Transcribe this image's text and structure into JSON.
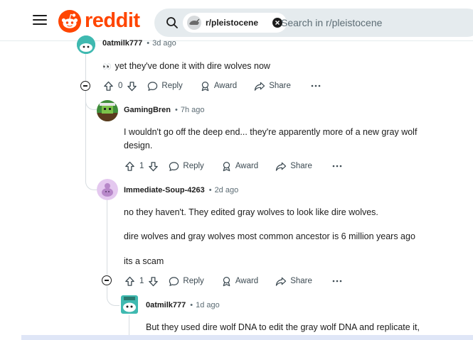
{
  "header": {
    "logo_text": "reddit",
    "search_chip": "r/pleistocene",
    "search_placeholder": "Search in r/pleistocene"
  },
  "comments": [
    {
      "username": "0atmilk777",
      "time": "3d ago",
      "emoji": "👀",
      "paragraphs": [
        "yet they've done it with dire wolves now"
      ],
      "votes": "0",
      "reply_label": "Reply",
      "award_label": "Award",
      "share_label": "Share"
    },
    {
      "username": "GamingBren",
      "time": "7h ago",
      "paragraphs": [
        "I wouldn't go off the deep end... they're apparently more of a new gray wolf",
        "design."
      ],
      "votes": "1",
      "reply_label": "Reply",
      "award_label": "Award",
      "share_label": "Share"
    },
    {
      "username": "Immediate-Soup-4263",
      "time": "2d ago",
      "paragraphs": [
        "no they haven't. They edited gray wolves to look like dire wolves.",
        "dire wolves and gray wolves most common ancestor is 6 million years ago",
        "its a scam"
      ],
      "votes": "1",
      "reply_label": "Reply",
      "award_label": "Award",
      "share_label": "Share"
    },
    {
      "username": "0atmilk777",
      "time": "1d ago",
      "paragraphs": [
        "But they used dire wolf DNA to edit the gray wolf DNA and replicate it,"
      ]
    }
  ],
  "colors": {
    "brand": "#ff4500",
    "meta_gray": "#5c6c74",
    "thread_line": "#d6dce0"
  }
}
